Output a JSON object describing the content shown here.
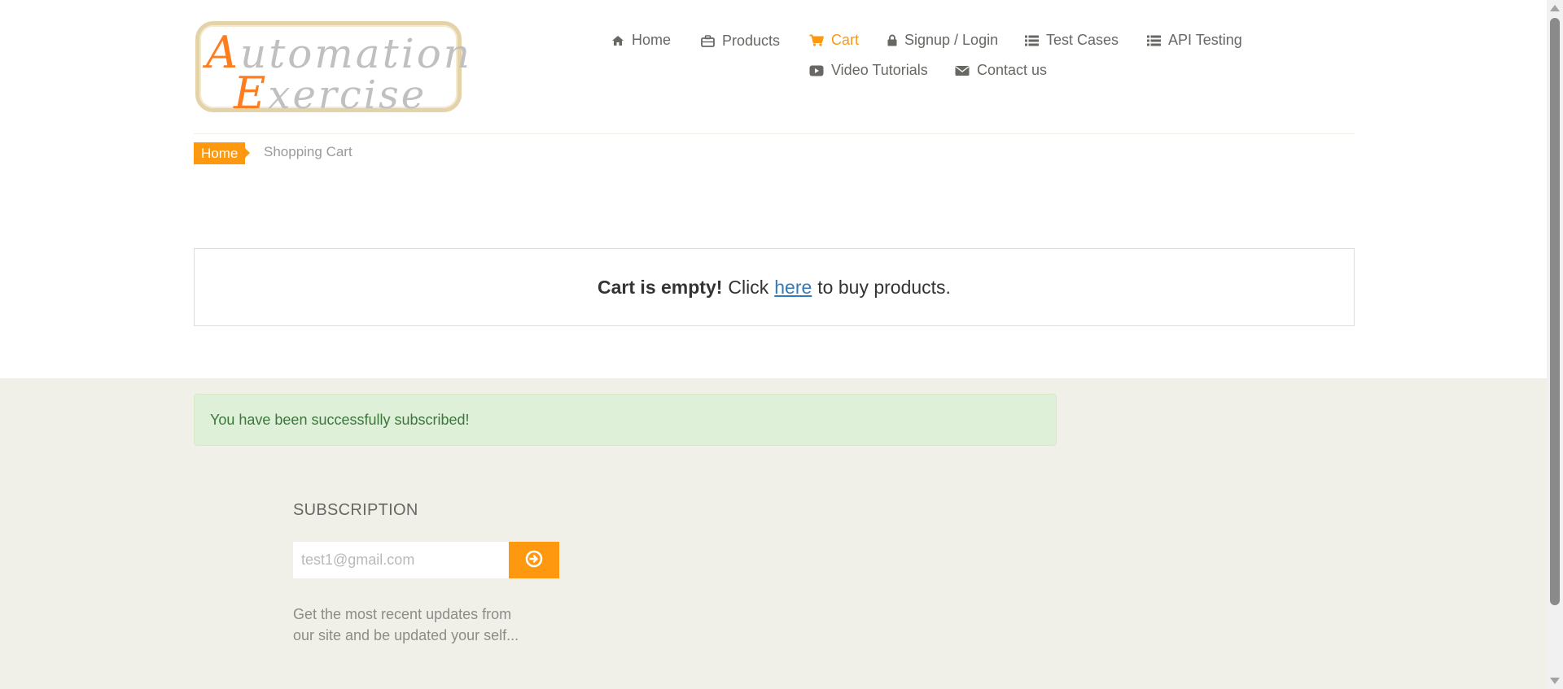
{
  "logo": {
    "line1_cap": "A",
    "line1_rest": "utomation",
    "line2_cap": "E",
    "line2_rest": "xercise"
  },
  "nav": {
    "home": "Home",
    "products": "Products",
    "cart": "Cart",
    "signup_login": "Signup / Login",
    "test_cases": "Test Cases",
    "api_testing": "API Testing",
    "video_tutorials": "Video Tutorials",
    "contact_us": "Contact us",
    "active_item": "Cart"
  },
  "breadcrumb": {
    "home": "Home",
    "current": "Shopping Cart"
  },
  "cart": {
    "empty_bold": "Cart is empty!",
    "click": "Click",
    "link": "here",
    "suffix": "to buy products."
  },
  "footer": {
    "alert": "You have been successfully subscribed!",
    "subscription_title": "SUBSCRIPTION",
    "email_value": "test1@gmail.com",
    "description": "Get the most recent updates from our site and be updated your self..."
  },
  "colors": {
    "accent": "#fe980f",
    "footer_bg": "#f0f0e9",
    "success_bg": "#dff0d8",
    "link": "#337ab7"
  },
  "icons": [
    "home-icon",
    "briefcase-icon",
    "shopping-cart-icon",
    "lock-icon",
    "list-icon",
    "list-icon",
    "youtube-play-icon",
    "envelope-icon",
    "arrow-circle-right-icon"
  ]
}
